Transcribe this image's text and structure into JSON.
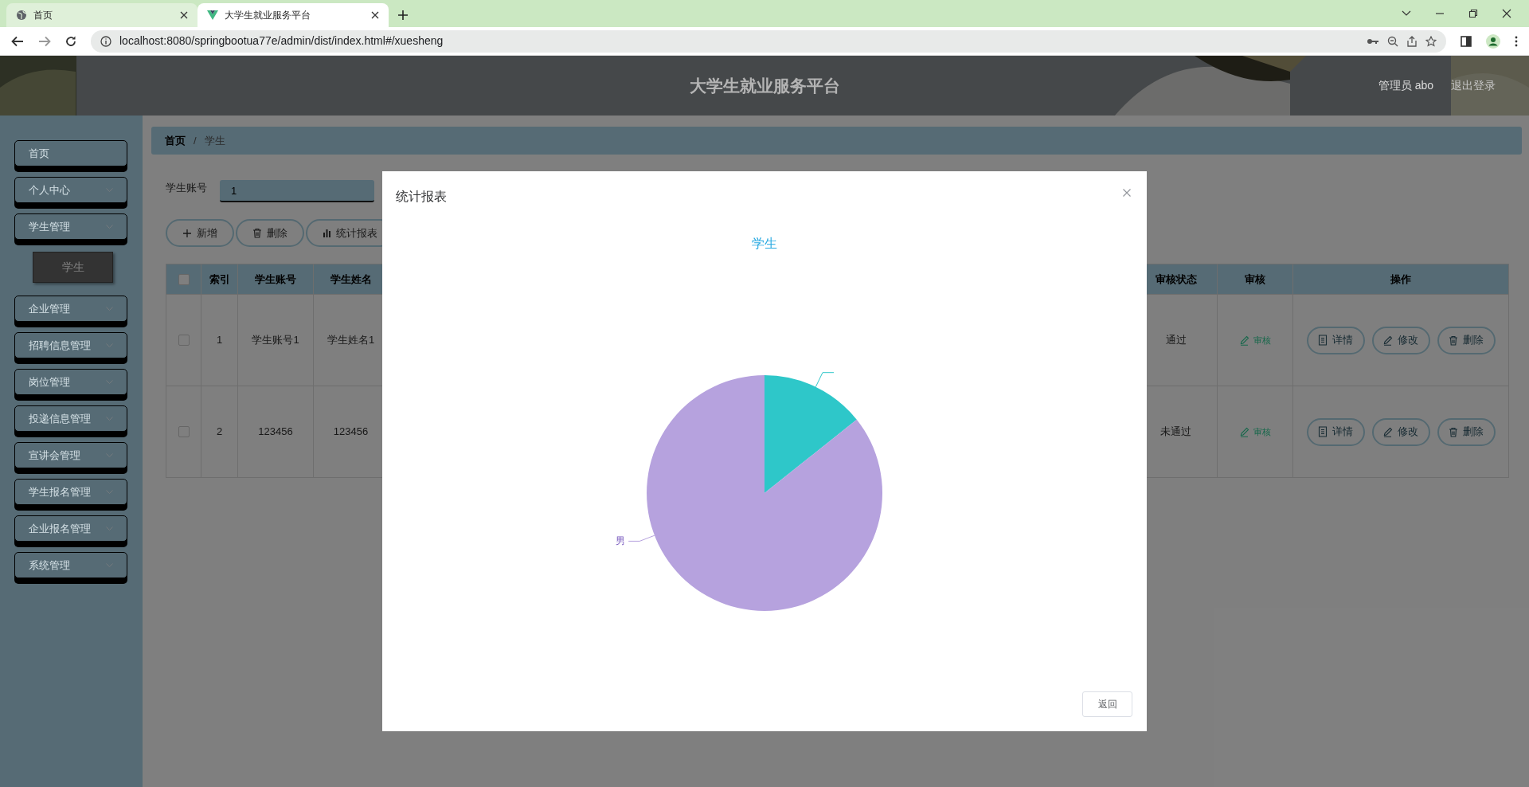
{
  "browser": {
    "tabs": [
      {
        "title": "首页",
        "selected": false
      },
      {
        "title": "大学生就业服务平台",
        "selected": true
      }
    ],
    "url": "localhost:8080/springbootua77e/admin/dist/index.html#/xuesheng"
  },
  "header": {
    "title": "大学生就业服务平台",
    "user": "管理员 abo",
    "logout": "退出登录"
  },
  "sidebar": {
    "items": [
      {
        "label": "首页",
        "expandable": false
      },
      {
        "label": "个人中心",
        "expandable": true
      },
      {
        "label": "学生管理",
        "expandable": true,
        "children": [
          {
            "label": "学生"
          }
        ]
      },
      {
        "label": "企业管理",
        "expandable": true
      },
      {
        "label": "招聘信息管理",
        "expandable": true
      },
      {
        "label": "岗位管理",
        "expandable": true
      },
      {
        "label": "投递信息管理",
        "expandable": true
      },
      {
        "label": "宣讲会管理",
        "expandable": true
      },
      {
        "label": "学生报名管理",
        "expandable": true
      },
      {
        "label": "企业报名管理",
        "expandable": true
      },
      {
        "label": "系统管理",
        "expandable": true
      }
    ]
  },
  "breadcrumb": {
    "items": [
      "首页",
      "学生"
    ],
    "separator": "/"
  },
  "search": {
    "label": "学生账号",
    "value": "1"
  },
  "actions": [
    {
      "label": "新增",
      "kind": "plus"
    },
    {
      "label": "删除",
      "kind": "trash"
    },
    {
      "label": "统计报表",
      "kind": "bars"
    }
  ],
  "table": {
    "select_all_checked": false,
    "columns_left": [
      "索引",
      "学生账号",
      "学生姓名"
    ],
    "columns_right": [
      "审核状态",
      "审核",
      "操作"
    ],
    "rows": [
      {
        "checked": false,
        "index": "1",
        "account": "学生账号1",
        "name": "学生姓名1",
        "status": "通过",
        "review": "审核",
        "ops": [
          {
            "label": "详情",
            "kind": "doc"
          },
          {
            "label": "修改",
            "kind": "pen"
          },
          {
            "label": "删除",
            "kind": "trash"
          }
        ]
      },
      {
        "checked": false,
        "index": "2",
        "account": "123456",
        "name": "123456",
        "status": "未通过",
        "review": "审核",
        "ops": [
          {
            "label": "详情",
            "kind": "doc"
          },
          {
            "label": "修改",
            "kind": "pen"
          },
          {
            "label": "删除",
            "kind": "trash"
          }
        ]
      }
    ]
  },
  "dialog": {
    "title": "统计报表",
    "button": "返回",
    "chart_data": {
      "type": "pie",
      "title": "学生",
      "categories": [
        null,
        "男"
      ],
      "series": [
        {
          "values": [
            14.3,
            85.7
          ]
        }
      ]
    }
  }
}
